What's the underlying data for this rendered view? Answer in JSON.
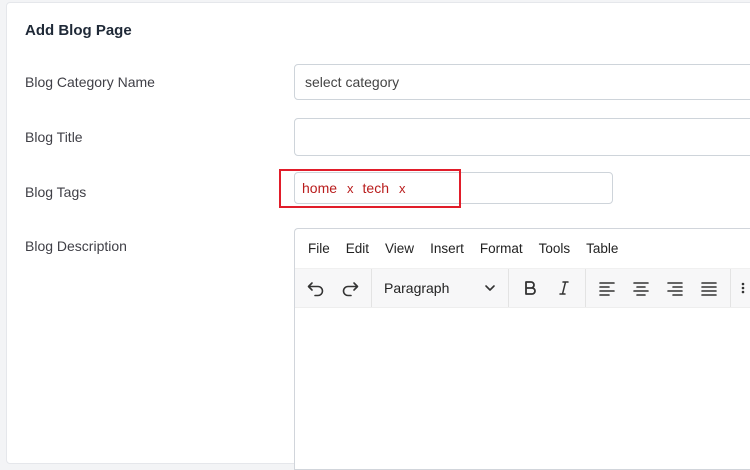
{
  "page": {
    "title": "Add Blog Page"
  },
  "form": {
    "category_label": "Blog Category Name",
    "category_value": "select category",
    "title_label": "Blog Title",
    "title_value": "",
    "tags_label": "Blog Tags",
    "tags": [
      {
        "text": "home",
        "remove": "x"
      },
      {
        "text": "tech",
        "remove": "x"
      }
    ],
    "description_label": "Blog Description"
  },
  "editor": {
    "menu": [
      "File",
      "Edit",
      "View",
      "Insert",
      "Format",
      "Tools",
      "Table"
    ],
    "block_format": "Paragraph",
    "toolbar_icons": [
      "undo-icon",
      "redo-icon",
      "bold-icon",
      "italic-icon",
      "align-left-icon",
      "align-center-icon",
      "align-right-icon",
      "align-justify-icon",
      "more-icon"
    ]
  },
  "colors": {
    "tag_text": "#b91c1c",
    "highlight_border": "#e11d2a"
  }
}
